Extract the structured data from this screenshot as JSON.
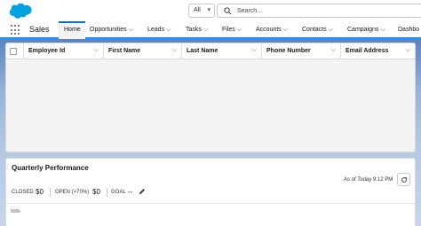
{
  "header": {
    "search_scope": "All",
    "search_placeholder": "Search..."
  },
  "nav": {
    "app_name": "Sales",
    "items": [
      {
        "label": "Home"
      },
      {
        "label": "Opportunities"
      },
      {
        "label": "Leads"
      },
      {
        "label": "Tasks"
      },
      {
        "label": "Files"
      },
      {
        "label": "Accounts"
      },
      {
        "label": "Contacts"
      },
      {
        "label": "Campaigns"
      },
      {
        "label": "Dashbo"
      }
    ]
  },
  "table": {
    "columns": [
      "Employee Id",
      "First Name",
      "Last Name",
      "Phone Number",
      "Email Address"
    ],
    "rows": []
  },
  "performance": {
    "title": "Quarterly Performance",
    "as_of": "As of Today 9:12 PM",
    "closed_label": "CLOSED",
    "closed_value": "$0",
    "open_label": "OPEN (>70%)",
    "open_value": "$0",
    "goal_label": "GOAL",
    "goal_value": "--",
    "axis_top_label": "500k"
  },
  "colors": {
    "brand_blue": "#0176d3",
    "logo_blue": "#00a1e0",
    "active_underline": "#1b96ff"
  }
}
